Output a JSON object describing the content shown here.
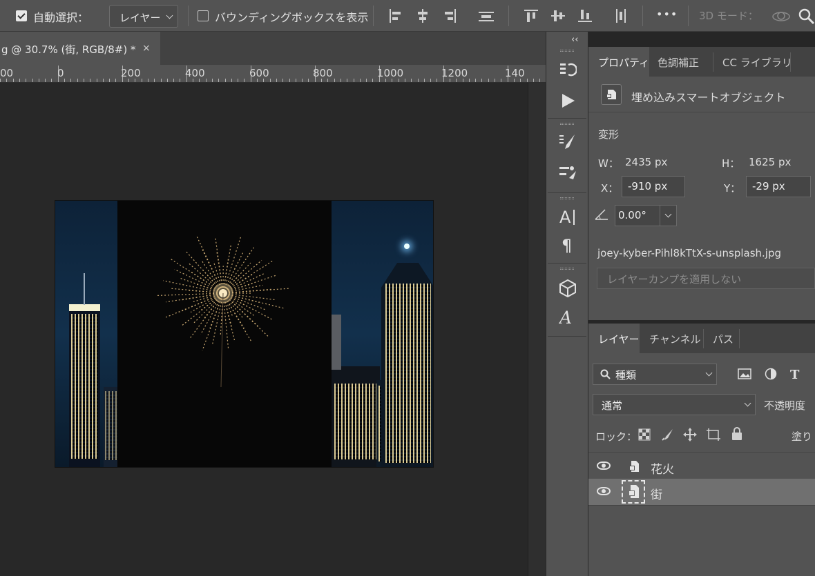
{
  "options_bar": {
    "auto_select_label": "自動選択：",
    "auto_select_checked": true,
    "auto_select_target": "レイヤー",
    "show_bbox_label": "バウンディングボックスを表示",
    "show_bbox_checked": false,
    "more_label": "•••",
    "mode_3d_label": "3D モード："
  },
  "document": {
    "tab_title": "g @ 30.7% (街, RGB/8#) *",
    "close_glyph": "×"
  },
  "ruler": {
    "labels": [
      "00",
      "0",
      "200",
      "400",
      "600",
      "800",
      "1000",
      "1200",
      "140"
    ]
  },
  "toolstrip": {
    "collapse_glyph": "‹‹"
  },
  "properties_panel": {
    "tabs": [
      "プロパティ",
      "色調補正",
      "CC ライブラリ"
    ],
    "active_tab": 0,
    "object_type": "埋め込みスマートオブジェクト",
    "transform_title": "変形",
    "w_label": "W：",
    "w_value": "2435 px",
    "h_label": "H：",
    "h_value": "1625 px",
    "x_label": "X：",
    "x_value": "-910 px",
    "y_label": "Y：",
    "y_value": "-29 px",
    "angle_value": "0.00°",
    "filename": "joey-kyber-Pihl8kTtX-s-unsplash.jpg",
    "layer_comp_placeholder": "レイヤーカンプを適用しない"
  },
  "layers_panel": {
    "tabs": [
      "レイヤー",
      "チャンネル",
      "パス"
    ],
    "active_tab": 0,
    "filter_label": "種類",
    "blend_mode": "通常",
    "opacity_label": "不透明度",
    "lock_label": "ロック：",
    "fill_label": "塗り",
    "layers": [
      {
        "name": "花火",
        "visible": true,
        "selected": false
      },
      {
        "name": "街",
        "visible": true,
        "selected": true
      }
    ]
  }
}
